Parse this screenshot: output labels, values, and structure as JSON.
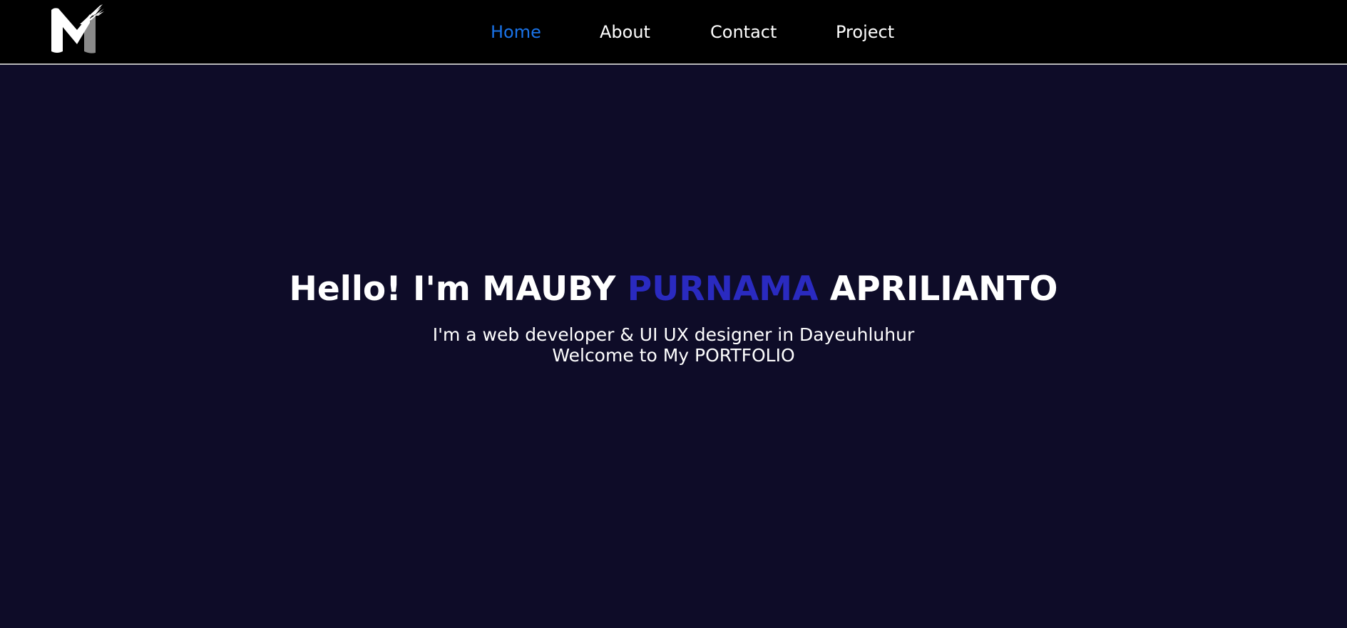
{
  "header": {
    "logo_icon": "m-brush-logo-icon",
    "nav": [
      {
        "label": "Home",
        "active": true
      },
      {
        "label": "About",
        "active": false
      },
      {
        "label": "Contact",
        "active": false
      },
      {
        "label": "Project",
        "active": false
      }
    ]
  },
  "hero": {
    "greeting": "Hello! I'm",
    "first_name": "MAUBY",
    "middle_name": "PURNAMA",
    "last_name": "APRILIANTO",
    "subtitle_line1": "I'm a web developer & UI UX designer in Dayeuhluhur",
    "subtitle_line2": "Welcome to My PORTFOLIO"
  },
  "colors": {
    "page_background": "#0e0c28",
    "navbar_background": "#000000",
    "nav_active": "#1a73e8",
    "name_accent": "#2a2ac0",
    "text": "#ffffff"
  }
}
